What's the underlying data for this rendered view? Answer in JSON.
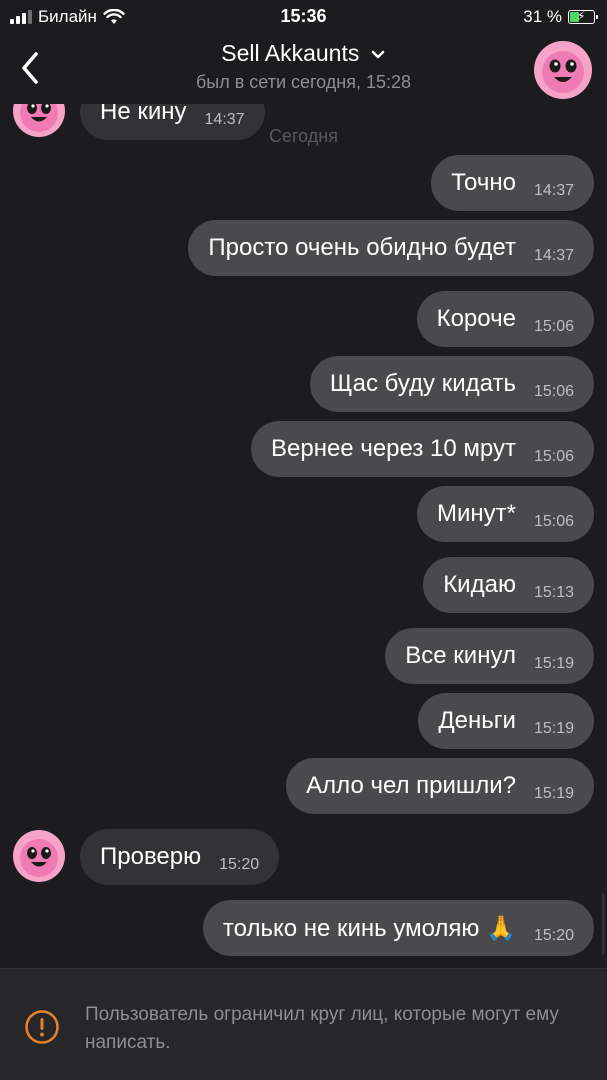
{
  "status_bar": {
    "carrier": "Билайн",
    "time": "15:36",
    "battery_percent": "31 %",
    "battery_level": 0.31,
    "signal_bars": 3
  },
  "header": {
    "back_icon": "chevron-left-icon",
    "contact_name": "Sell Akkaunts",
    "dropdown_icon": "chevron-down-icon",
    "last_seen": "был в сети сегодня, 15:28"
  },
  "date_separator": "Сегодня",
  "messages": [
    {
      "direction": "in",
      "text": "Не кину",
      "time": "14:37"
    },
    {
      "direction": "out",
      "text": "Точно",
      "time": "14:37"
    },
    {
      "direction": "out",
      "text": "Просто очень обидно будет",
      "time": "14:37"
    },
    {
      "direction": "out",
      "text": "Короче",
      "time": "15:06"
    },
    {
      "direction": "out",
      "text": "Щас буду кидать",
      "time": "15:06"
    },
    {
      "direction": "out",
      "text": "Вернее через 10 мрут",
      "time": "15:06"
    },
    {
      "direction": "out",
      "text": "Минут*",
      "time": "15:06"
    },
    {
      "direction": "out",
      "text": "Кидаю",
      "time": "15:13"
    },
    {
      "direction": "out",
      "text": "Все кинул",
      "time": "15:19"
    },
    {
      "direction": "out",
      "text": "Деньги",
      "time": "15:19"
    },
    {
      "direction": "out",
      "text": "Алло чел пришли?",
      "time": "15:19"
    },
    {
      "direction": "in",
      "text": "Проверю",
      "time": "15:20"
    },
    {
      "direction": "out",
      "text": "только не кинь умоляю 🙏",
      "time": "15:20"
    }
  ],
  "footer": {
    "icon": "warning-circle-icon",
    "notice": "Пользователь ограничил круг лиц, которые могут ему написать."
  },
  "colors": {
    "background": "#1c1c1e",
    "bubble_out": "#4a4a4c",
    "bubble_in": "#333336",
    "warning_orange": "#e8822a",
    "avatar_pink": "#f5a3c8"
  }
}
